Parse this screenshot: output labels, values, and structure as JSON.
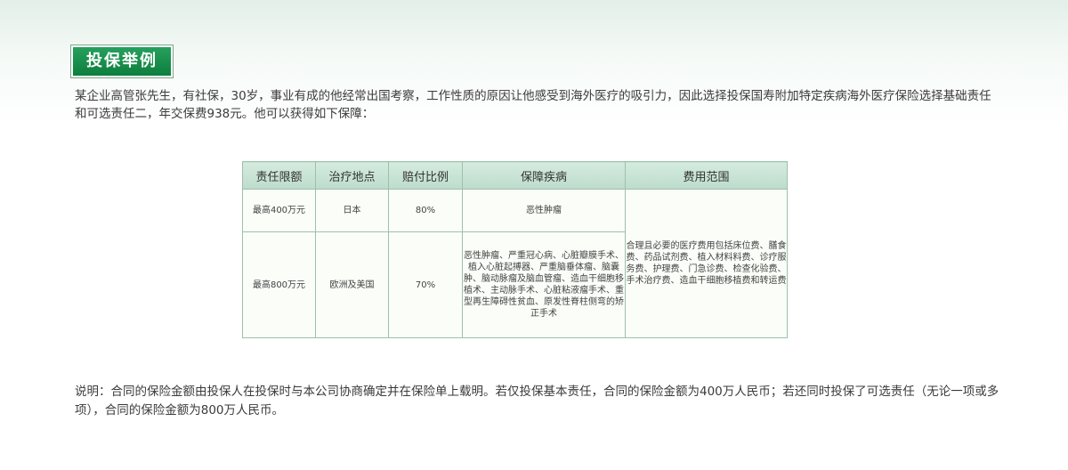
{
  "header": {
    "badge_title": "投保举例"
  },
  "intro": {
    "text": "某企业高管张先生，有社保，30岁，事业有成的他经常出国考察，工作性质的原因让他感受到海外医疗的吸引力，因此选择投保国寿附加特定疾病海外医疗保险选择基础责任和可选责任二，年交保费938元。他可以获得如下保障："
  },
  "table": {
    "headers": [
      "责任限额",
      "治疗地点",
      "赔付比例",
      "保障疾病",
      "费用范围"
    ],
    "rows": [
      {
        "limit": "最高400万元",
        "location": "日本",
        "ratio": "80%",
        "disease": "恶性肿瘤"
      },
      {
        "limit": "最高800万元",
        "location": "欧洲及美国",
        "ratio": "70%",
        "disease": "恶性肿瘤、严重冠心病、心脏瓣膜手术、植入心脏起搏器、严重脑垂体瘤、脑囊肿、脑动脉瘤及脑血管瘤、造血干细胞移植术、主动脉手术、心脏粘液瘤手术、重型再生障碍性贫血、原发性脊柱侧弯的矫正手术"
      }
    ],
    "fee_scope": "合理且必要的医疗费用包括床位费、膳食费、药品试剂费、植入材料料费、诊疗服务费、护理费、门急诊费、检查化验费、手术治疗费、造血干细胞移植费和转运费"
  },
  "note": {
    "text": "说明：合同的保险金额由投保人在投保时与本公司协商确定并在保险单上载明。若仅投保基本责任，合同的保险金额为400万人民币；若还同时投保了可选责任（无论一项或多项），合同的保险金额为800万人民币。"
  }
}
